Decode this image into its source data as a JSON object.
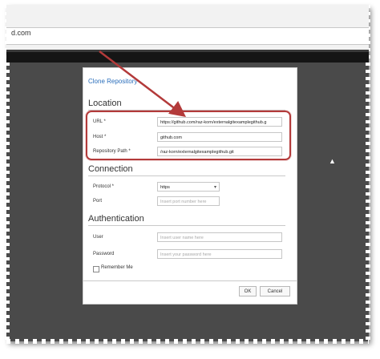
{
  "browser": {
    "url_fragment": "d.com"
  },
  "dialog": {
    "title": "Clone Repository",
    "sections": {
      "location": "Location",
      "connection": "Connection",
      "authentication": "Authentication"
    },
    "fields": {
      "url": {
        "label": "URL *",
        "value": "https://github.com/raz-korn/externalgitexamplegithub.g"
      },
      "host": {
        "label": "Host *",
        "value": "github.com"
      },
      "repo_path": {
        "label": "Repository Path *",
        "value": "/raz-korn/externalgitexamplegithub.git"
      },
      "protocol": {
        "label": "Protocol *",
        "value": "https"
      },
      "port": {
        "label": "Port",
        "placeholder": "Insert port number here"
      },
      "user": {
        "label": "User",
        "placeholder": "Insert user name here"
      },
      "password": {
        "label": "Password",
        "placeholder": "Insert your password here"
      }
    },
    "remember_me": "Remember Me",
    "buttons": {
      "ok": "OK",
      "cancel": "Cancel"
    }
  },
  "colors": {
    "annotation_red": "#b33a3a",
    "title_blue": "#2a6ebb",
    "frame_gray": "#4a4a4a"
  }
}
